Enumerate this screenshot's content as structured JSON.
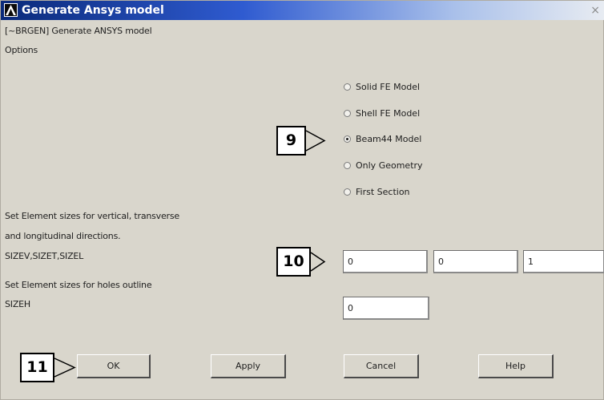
{
  "window": {
    "title": "Generate Ansys model",
    "close": "×"
  },
  "header": {
    "command": "[~BRGEN] Generate ANSYS model",
    "options": "Options"
  },
  "radios": [
    {
      "label": "Solid FE Model",
      "checked": false
    },
    {
      "label": "Shell FE Model",
      "checked": false
    },
    {
      "label": "Beam44 Model",
      "checked": true
    },
    {
      "label": "Only Geometry",
      "checked": false
    },
    {
      "label": "First Section",
      "checked": false
    }
  ],
  "sizes": {
    "desc1": "Set Element sizes for vertical, transverse",
    "desc2": "and longitudinal directions.",
    "param": "SIZEV,SIZET,SIZEL",
    "sizev": "0",
    "sizet": "0",
    "sizel": "1"
  },
  "holes": {
    "desc": "Set Element sizes for holes outline",
    "param": "SIZEH",
    "sizeh": "0"
  },
  "buttons": {
    "ok": "OK",
    "apply": "Apply",
    "cancel": "Cancel",
    "help": "Help"
  },
  "callouts": {
    "c9": "9",
    "c10": "10",
    "c11": "11"
  }
}
